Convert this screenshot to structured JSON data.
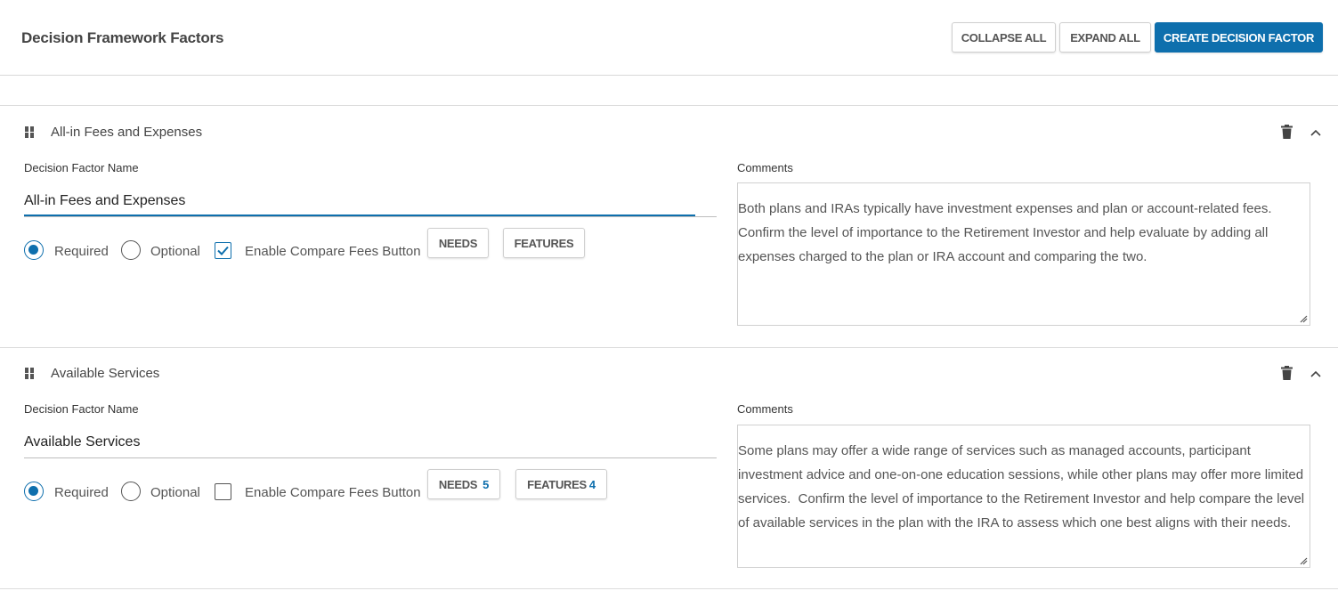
{
  "header": {
    "title": "Decision Framework Factors",
    "collapse_all": "COLLAPSE ALL",
    "expand_all": "EXPAND ALL",
    "create": "CREATE DECISION FACTOR"
  },
  "labels": {
    "name": "Decision Factor Name",
    "comments": "Comments",
    "required": "Required",
    "optional": "Optional",
    "enable_compare": "Enable Compare Fees Button",
    "needs": "NEEDS",
    "features": "FEATURES"
  },
  "factors": [
    {
      "title": "All-in Fees and Expenses",
      "name_value": "All-in Fees and Expenses",
      "required": true,
      "compare_enabled": true,
      "needs_count": "",
      "features_count": "",
      "comment": "Both plans and IRAs typically have investment expenses and plan or account-related fees.  Confirm the level of importance to the Retirement Investor and help evaluate by adding all expenses charged to the plan or IRA account and comparing the two."
    },
    {
      "title": "Available Services",
      "name_value": "Available Services",
      "required": true,
      "compare_enabled": false,
      "needs_count": "5",
      "features_count": "4",
      "comment": "Some plans may offer a wide range of services such as managed accounts, participant investment advice and one-on-one education sessions, while other plans may offer more limited services.  Confirm the level of importance to the Retirement Investor and help compare the level of available services in the plan with the IRA to assess which one best aligns with their needs."
    }
  ],
  "colors": {
    "accent": "#0e6fad"
  }
}
